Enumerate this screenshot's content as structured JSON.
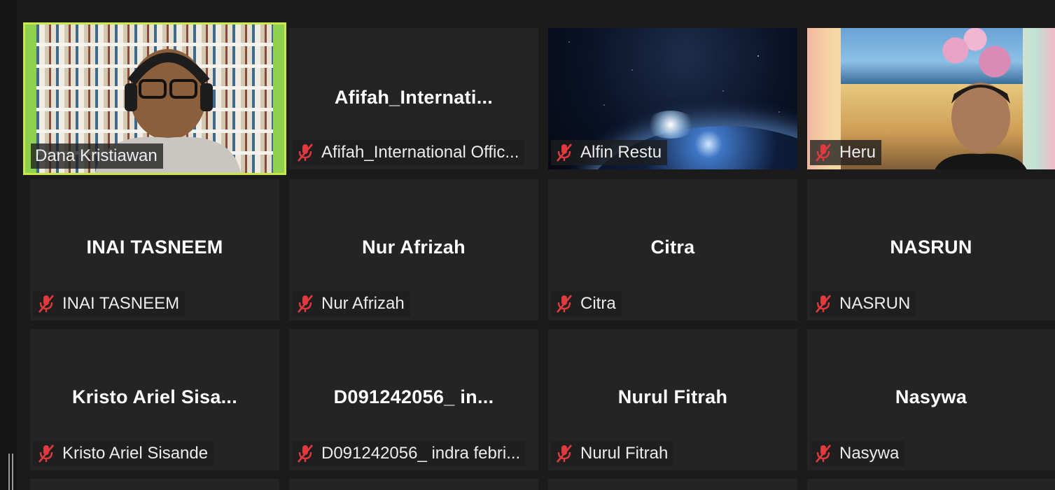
{
  "participants": [
    {
      "display_name": "Dana Kristiawan",
      "center_label": "",
      "muted": false,
      "video": "bookshelf",
      "active_speaker": true
    },
    {
      "display_name": "Afifah_International Offic...",
      "center_label": "Afifah_Internati...",
      "muted": true,
      "video": "",
      "active_speaker": false
    },
    {
      "display_name": "Alfin Restu",
      "center_label": "",
      "muted": true,
      "video": "earth-space",
      "active_speaker": false
    },
    {
      "display_name": "Heru",
      "center_label": "",
      "muted": true,
      "video": "scenic-collage",
      "active_speaker": false
    },
    {
      "display_name": "INAI TASNEEM",
      "center_label": "INAI TASNEEM",
      "muted": true,
      "video": "",
      "active_speaker": false
    },
    {
      "display_name": "Nur Afrizah",
      "center_label": "Nur Afrizah",
      "muted": true,
      "video": "",
      "active_speaker": false
    },
    {
      "display_name": "Citra",
      "center_label": "Citra",
      "muted": true,
      "video": "",
      "active_speaker": false
    },
    {
      "display_name": "NASRUN",
      "center_label": "NASRUN",
      "muted": true,
      "video": "",
      "active_speaker": false
    },
    {
      "display_name": "Kristo Ariel Sisande",
      "center_label": "Kristo Ariel Sisa...",
      "muted": true,
      "video": "",
      "active_speaker": false
    },
    {
      "display_name": "D091242056_ indra febri...",
      "center_label": "D091242056_ in...",
      "muted": true,
      "video": "",
      "active_speaker": false
    },
    {
      "display_name": "Nurul Fitrah",
      "center_label": "Nurul Fitrah",
      "muted": true,
      "video": "",
      "active_speaker": false
    },
    {
      "display_name": "Nasywa",
      "center_label": "Nasywa",
      "muted": true,
      "video": "",
      "active_speaker": false
    }
  ],
  "colors": {
    "active_speaker_border": "#c8e84e",
    "muted_icon": "#e0393e",
    "tile_background": "#242424"
  },
  "icons": {
    "muted": "microphone-muted-icon"
  }
}
